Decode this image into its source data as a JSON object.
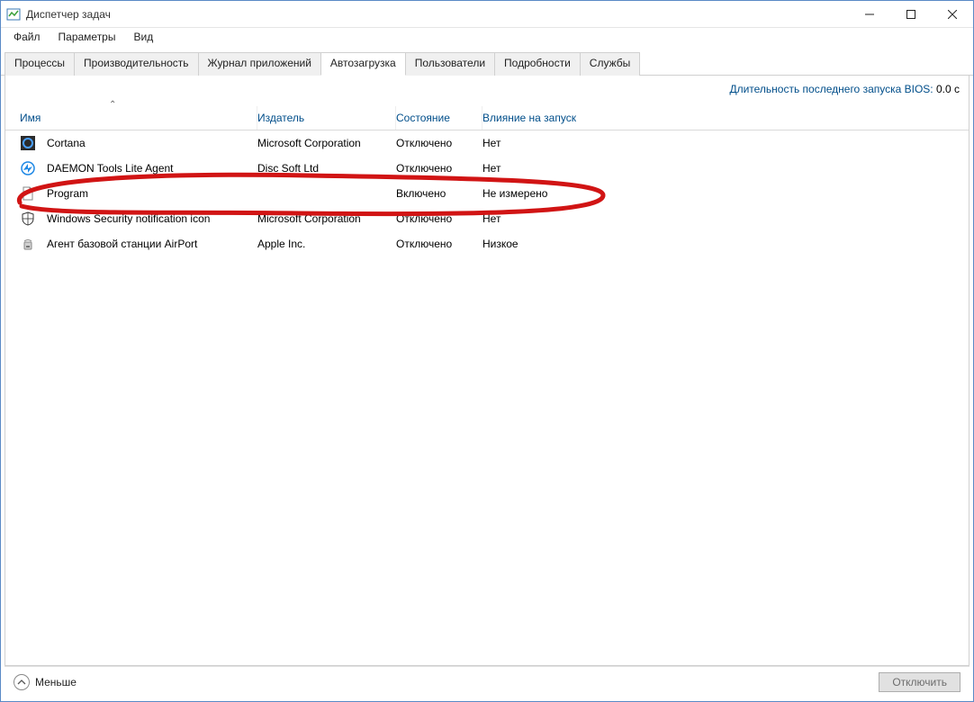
{
  "window": {
    "title": "Диспетчер задач"
  },
  "menu": {
    "file": "Файл",
    "options": "Параметры",
    "view": "Вид"
  },
  "tabs": {
    "processes": "Процессы",
    "performance": "Производительность",
    "app_history": "Журнал приложений",
    "startup": "Автозагрузка",
    "users": "Пользователи",
    "details": "Подробности",
    "services": "Службы"
  },
  "bios": {
    "label": "Длительность последнего запуска BIOS:",
    "value": "0.0 с"
  },
  "columns": {
    "name": "Имя",
    "publisher": "Издатель",
    "state": "Состояние",
    "impact": "Влияние на запуск"
  },
  "rows": [
    {
      "icon": "cortana",
      "name": "Cortana",
      "publisher": "Microsoft Corporation",
      "state": "Отключено",
      "impact": "Нет"
    },
    {
      "icon": "daemon",
      "name": "DAEMON Tools Lite Agent",
      "publisher": "Disc Soft Ltd",
      "state": "Отключено",
      "impact": "Нет"
    },
    {
      "icon": "file",
      "name": "Program",
      "publisher": "",
      "state": "Включено",
      "impact": "Не измерено"
    },
    {
      "icon": "shield",
      "name": "Windows Security notification icon",
      "publisher": "Microsoft Corporation",
      "state": "Отключено",
      "impact": "Нет"
    },
    {
      "icon": "airport",
      "name": "Агент базовой станции AirPort",
      "publisher": "Apple Inc.",
      "state": "Отключено",
      "impact": "Низкое"
    }
  ],
  "footer": {
    "fewer": "Меньше",
    "disable": "Отключить"
  }
}
